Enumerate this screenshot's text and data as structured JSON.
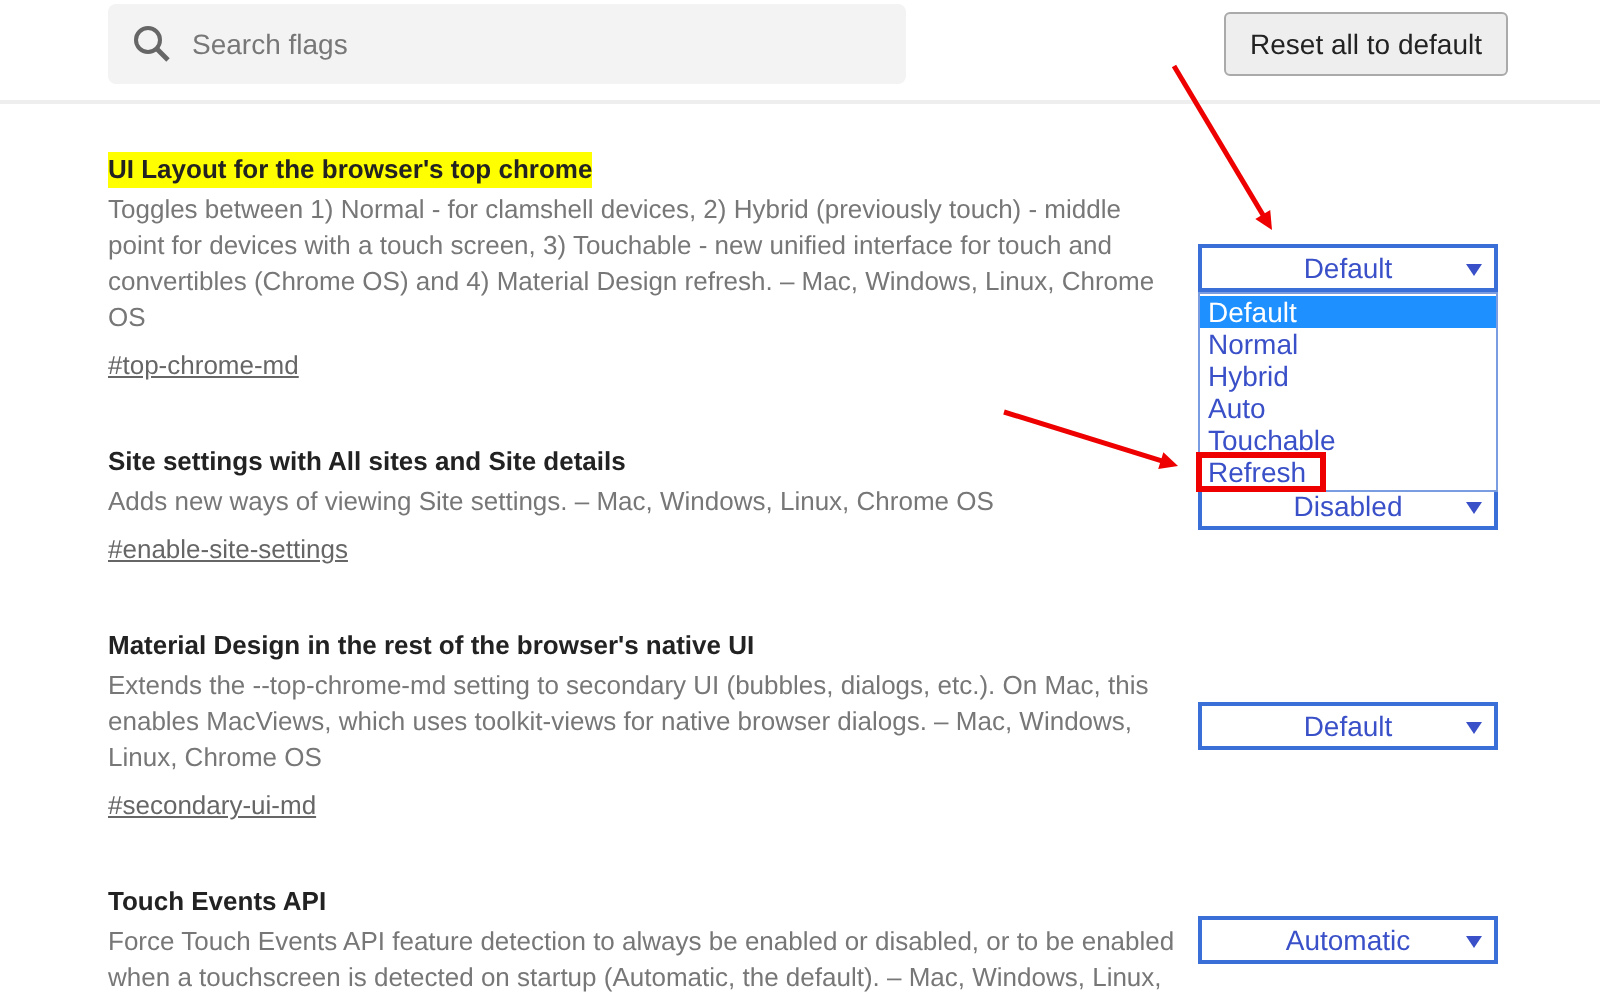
{
  "search": {
    "placeholder": "Search flags"
  },
  "reset_button": "Reset all to default",
  "experiments": [
    {
      "title": "UI Layout for the browser's top chrome",
      "highlighted": true,
      "description": "Toggles between 1) Normal - for clamshell devices, 2) Hybrid (previously touch) - middle point for devices with a touch screen, 3) Touchable - new unified interface for touch and convertibles (Chrome OS) and 4) Material Design refresh. – Mac, Windows, Linux, Chrome OS",
      "link": "#top-chrome-md",
      "select": {
        "value": "Default",
        "arrow": true,
        "expanded": true,
        "options": [
          {
            "label": "Default",
            "selected": true,
            "annotated": false
          },
          {
            "label": "Normal",
            "selected": false,
            "annotated": false
          },
          {
            "label": "Hybrid",
            "selected": false,
            "annotated": false
          },
          {
            "label": "Auto",
            "selected": false,
            "annotated": false
          },
          {
            "label": "Touchable",
            "selected": false,
            "annotated": false
          },
          {
            "label": "Refresh",
            "selected": false,
            "annotated": true
          }
        ]
      }
    },
    {
      "title": "Site settings with All sites and Site details",
      "highlighted": false,
      "description": "Adds new ways of viewing Site settings. – Mac, Windows, Linux, Chrome OS",
      "link": "#enable-site-settings",
      "select": {
        "value": "Disabled"
      }
    },
    {
      "title": "Material Design in the rest of the browser's native UI",
      "highlighted": false,
      "description": "Extends the --top-chrome-md setting to secondary UI (bubbles, dialogs, etc.). On Mac, this enables MacViews, which uses toolkit-views for native browser dialogs. – Mac, Windows, Linux, Chrome OS",
      "link": "#secondary-ui-md",
      "select": {
        "value": "Default"
      }
    },
    {
      "title": "Touch Events API",
      "highlighted": false,
      "description": "Force Touch Events API feature detection to always be enabled or disabled, or to be enabled when a touchscreen is detected on startup (Automatic, the default). – Mac, Windows, Linux,",
      "select": {
        "value": "Automatic"
      }
    }
  ]
}
